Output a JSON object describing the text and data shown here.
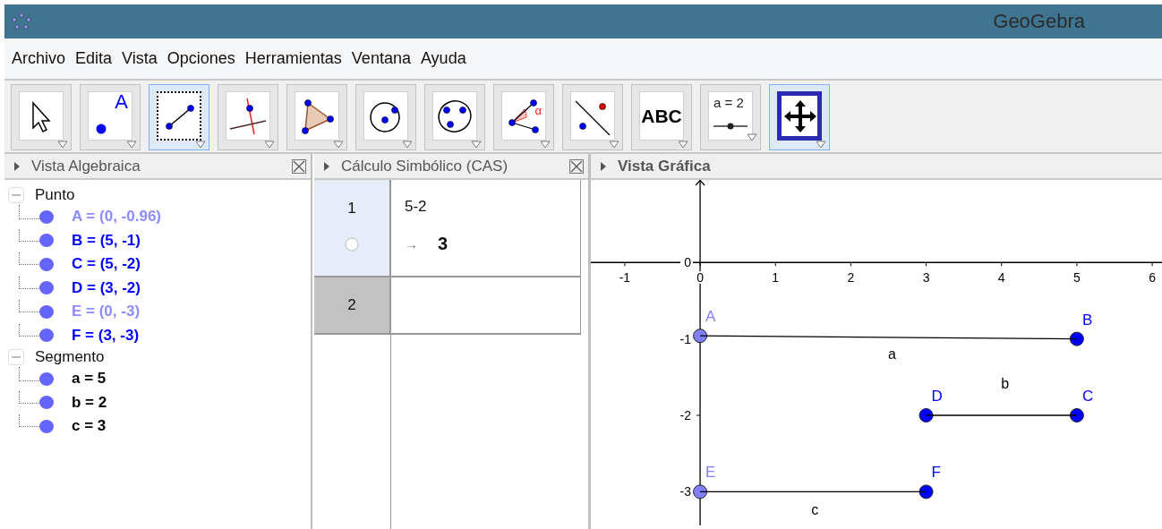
{
  "window": {
    "title": "GeoGebra"
  },
  "menu": [
    "Archivo",
    "Edita",
    "Vista",
    "Opciones",
    "Herramientas",
    "Ventana",
    "Ayuda"
  ],
  "toolbar": [
    {
      "kind": "move",
      "selected": false,
      "focused": false
    },
    {
      "kind": "point",
      "label": "A",
      "selected": false,
      "focused": false
    },
    {
      "kind": "segment",
      "selected": false,
      "focused": true
    },
    {
      "kind": "perpendicular",
      "selected": false,
      "focused": false
    },
    {
      "kind": "polygon",
      "selected": false,
      "focused": false
    },
    {
      "kind": "circle",
      "selected": false,
      "focused": false
    },
    {
      "kind": "conic",
      "selected": false,
      "focused": false
    },
    {
      "kind": "angle",
      "label": "α",
      "selected": false,
      "focused": false
    },
    {
      "kind": "reflect",
      "selected": false,
      "focused": false
    },
    {
      "kind": "text",
      "label": "ABC",
      "selected": false,
      "focused": false
    },
    {
      "kind": "slider",
      "label": "a = 2",
      "selected": false,
      "focused": false
    },
    {
      "kind": "move_view",
      "selected": true,
      "focused": false
    }
  ],
  "algebra_view": {
    "title": "Vista Algebraica",
    "groups": [
      {
        "label": "Punto",
        "expanded": true,
        "children": [
          {
            "text": "A = (0, -0.96)",
            "color": "#8c8cff"
          },
          {
            "text": "B = (5, -1)",
            "color": "#0000ff"
          },
          {
            "text": "C = (5, -2)",
            "color": "#0000ff"
          },
          {
            "text": "D = (3, -2)",
            "color": "#0000ff"
          },
          {
            "text": "E = (0, -3)",
            "color": "#8c8cff"
          },
          {
            "text": "F = (3, -3)",
            "color": "#0000ff"
          }
        ]
      },
      {
        "label": "Segmento",
        "expanded": true,
        "children": [
          {
            "text": "a = 5",
            "color": "#000000"
          },
          {
            "text": "b = 2",
            "color": "#000000"
          },
          {
            "text": "c = 3",
            "color": "#000000"
          }
        ]
      }
    ]
  },
  "cas_view": {
    "title": "Cálculo Simbólico (CAS)",
    "rows": [
      {
        "number": "1",
        "input": "5-2",
        "arrow": "→",
        "output": "3",
        "plotted": false,
        "selected": false
      },
      {
        "number": "2",
        "selected": true
      }
    ]
  },
  "graphics_view": {
    "title": "Vista Gráfica",
    "chart_data": {
      "type": "line",
      "xlim": [
        -1.45,
        6.13
      ],
      "ylim": [
        -3.44,
        1.08
      ],
      "xticks": [
        -1,
        0,
        1,
        2,
        3,
        4,
        5,
        6
      ],
      "yticks": [
        -3,
        -2,
        -1,
        0
      ],
      "series": [
        {
          "name": "A",
          "color": "#7f7fff",
          "marker": "circle",
          "x": [
            0
          ],
          "values": [
            -0.96
          ]
        },
        {
          "name": "B",
          "color": "#0000ff",
          "marker": "circle",
          "x": [
            5
          ],
          "values": [
            -1
          ]
        },
        {
          "name": "C",
          "color": "#0000ff",
          "marker": "circle",
          "x": [
            5
          ],
          "values": [
            -2
          ]
        },
        {
          "name": "D",
          "color": "#0000ff",
          "marker": "circle",
          "x": [
            3
          ],
          "values": [
            -2
          ]
        },
        {
          "name": "E",
          "color": "#7f7fff",
          "marker": "circle",
          "x": [
            0
          ],
          "values": [
            -3
          ]
        },
        {
          "name": "F",
          "color": "#0000ff",
          "marker": "circle",
          "x": [
            3
          ],
          "values": [
            -3
          ]
        },
        {
          "color": "#000000",
          "x": [
            0,
            5
          ],
          "values": [
            -0.96,
            -1
          ]
        },
        {
          "color": "#000000",
          "x": [
            3,
            5
          ],
          "values": [
            -2,
            -2
          ]
        },
        {
          "color": "#000000",
          "x": [
            0,
            3
          ],
          "values": [
            -3,
            -3
          ]
        }
      ],
      "annotations": [
        "a",
        "b",
        "c"
      ]
    }
  }
}
